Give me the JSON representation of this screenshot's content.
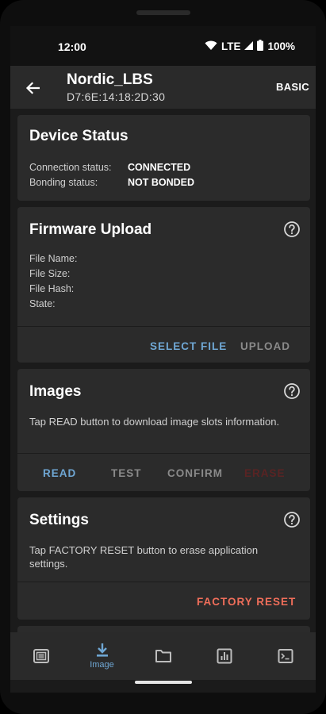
{
  "status_bar": {
    "time": "12:00",
    "network": "LTE",
    "battery": "100%"
  },
  "app_bar": {
    "title": "Nordic_LBS",
    "subtitle": "D7:6E:14:18:2D:30",
    "mode_button": "BASIC",
    "back_icon": "arrow-back-icon"
  },
  "device_status": {
    "title": "Device Status",
    "rows": [
      {
        "label": "Connection status:",
        "value": "CONNECTED"
      },
      {
        "label": "Bonding status:",
        "value": "NOT BONDED"
      }
    ]
  },
  "firmware_upload": {
    "title": "Firmware Upload",
    "fields": [
      "File Name:",
      "File Size:",
      "File Hash:",
      "State:"
    ],
    "actions": {
      "select_file": "SELECT FILE",
      "upload": "UPLOAD"
    }
  },
  "images": {
    "title": "Images",
    "description": "Tap READ button to download image slots information.",
    "actions": {
      "read": "READ",
      "test": "TEST",
      "confirm": "CONFIRM",
      "erase": "ERASE"
    }
  },
  "settings": {
    "title": "Settings",
    "description": "Tap FACTORY RESET button to erase application settings.",
    "actions": {
      "factory_reset": "FACTORY RESET"
    }
  },
  "bottom_nav": {
    "items": [
      {
        "icon": "device-icon",
        "label": ""
      },
      {
        "icon": "download-icon",
        "label": "Image"
      },
      {
        "icon": "folder-icon",
        "label": ""
      },
      {
        "icon": "stats-icon",
        "label": ""
      },
      {
        "icon": "logs-icon",
        "label": ""
      }
    ],
    "selected_index": 1
  },
  "colors": {
    "accent": "#6fa7d4",
    "danger": "#ef6e5a",
    "card": "#2b2b2b",
    "background": "#1b1b1b"
  }
}
